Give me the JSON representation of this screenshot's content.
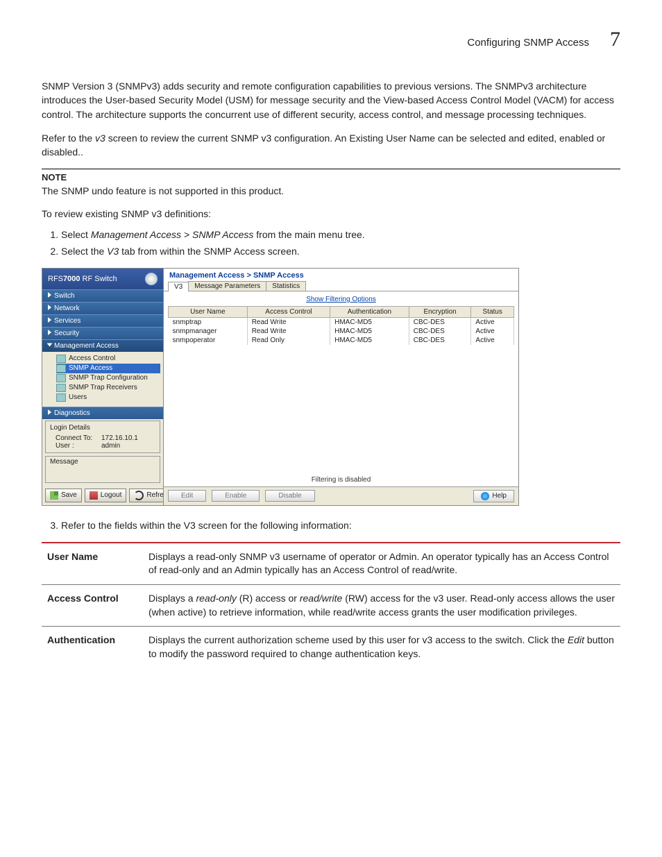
{
  "header": {
    "title": "Configuring SNMP Access",
    "chapter": "7"
  },
  "para1": "SNMP Version 3 (SNMPv3) adds security and remote configuration capabilities to previous versions. The SNMPv3 architecture introduces the User-based Security Model (USM) for message security and the View-based Access Control Model (VACM) for access control. The architecture supports the concurrent use of different security, access control, and message processing techniques.",
  "para2_pre": "Refer to the ",
  "para2_it": "v3",
  "para2_post": " screen to review the current SNMP v3 configuration. An Existing User Name can be selected and edited, enabled or disabled..",
  "note_label": "NOTE",
  "note_text": "The SNMP undo feature is not supported in this product.",
  "lead": "To review existing SNMP v3 definitions:",
  "step1_pre": "Select ",
  "step1_it": "Management Access > SNMP Access",
  "step1_post": " from the main menu tree.",
  "step2_pre": "Select the ",
  "step2_it": "V3",
  "step2_post": " tab from within the SNMP Access screen.",
  "step3": "Refer to the fields within the V3 screen for the following information:",
  "ui": {
    "brand_pre": "RFS",
    "brand_bold": "7000",
    "brand_post": " RF Switch",
    "nav": [
      "Switch",
      "Network",
      "Services",
      "Security",
      "Management Access",
      "Diagnostics"
    ],
    "sub": [
      "Access Control",
      "SNMP Access",
      "SNMP Trap Configuration",
      "SNMP Trap Receivers",
      "Users"
    ],
    "login_title": "Login Details",
    "connect_lbl": "Connect To:",
    "connect_val": "172.16.10.1",
    "user_lbl": "User :",
    "user_val": "admin",
    "msg_title": "Message",
    "save": "Save",
    "logout": "Logout",
    "refresh": "Refresh",
    "crumb": "Management Access > SNMP Access",
    "tabs": [
      "V3",
      "Message Parameters",
      "Statistics"
    ],
    "filter_link": "Show Filtering Options",
    "cols": [
      "User Name",
      "Access Control",
      "Authentication",
      "Encryption",
      "Status"
    ],
    "rows": [
      [
        "snmptrap",
        "Read Write",
        "HMAC-MD5",
        "CBC-DES",
        "Active"
      ],
      [
        "snmpmanager",
        "Read Write",
        "HMAC-MD5",
        "CBC-DES",
        "Active"
      ],
      [
        "snmpoperator",
        "Read Only",
        "HMAC-MD5",
        "CBC-DES",
        "Active"
      ]
    ],
    "filter_status": "Filtering is disabled",
    "edit": "Edit",
    "enable": "Enable",
    "disable": "Disable",
    "help": "Help"
  },
  "defs": [
    {
      "k": "User Name",
      "v": "Displays a read-only SNMP v3 username of operator or Admin. An operator typically has an Access Control of read-only and an Admin typically has an Access Control of read/write."
    },
    {
      "k": "Access Control",
      "v_pre": "Displays a ",
      "v_it1": "read-only",
      "v_mid1": " (R) access or ",
      "v_it2": "read/write",
      "v_mid2": " (RW) access for the v3 user. Read-only access allows the user (when active) to retrieve information, while read/write access grants the user modification privileges."
    },
    {
      "k": "Authentication",
      "v_pre": "Displays the current authorization scheme used by this user for v3 access to the switch. Click the ",
      "v_it1": "Edit",
      "v_post": " button to modify the password required to change authentication keys."
    }
  ]
}
